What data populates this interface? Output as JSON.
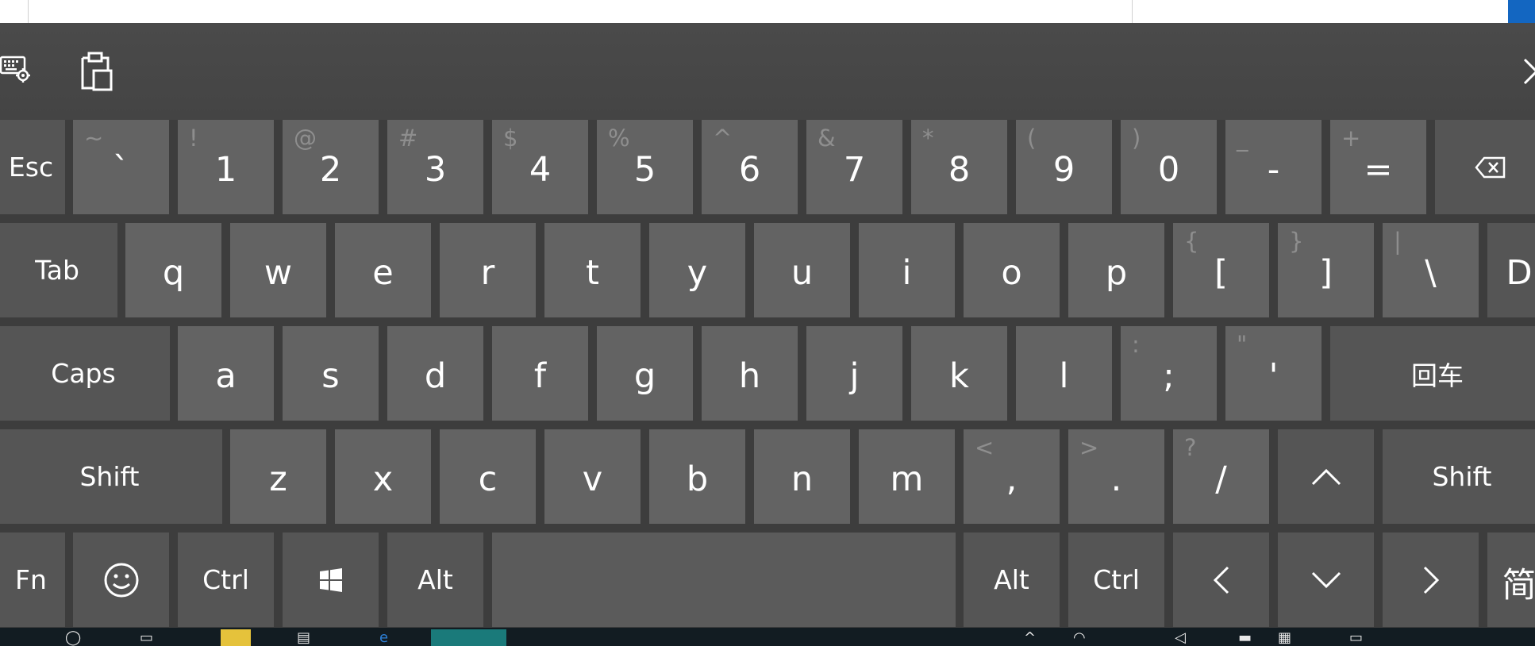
{
  "toolbar": {
    "settings_icon": "keyboard-settings-icon",
    "clipboard_icon": "clipboard-icon",
    "close_icon": "close-icon"
  },
  "rows": [
    [
      {
        "id": "esc",
        "main": "Esc"
      },
      {
        "id": "backtick",
        "main": "`",
        "sec": "~"
      },
      {
        "id": "1",
        "main": "1",
        "sec": "!"
      },
      {
        "id": "2",
        "main": "2",
        "sec": "@"
      },
      {
        "id": "3",
        "main": "3",
        "sec": "#"
      },
      {
        "id": "4",
        "main": "4",
        "sec": "$"
      },
      {
        "id": "5",
        "main": "5",
        "sec": "%"
      },
      {
        "id": "6",
        "main": "6",
        "sec": "^"
      },
      {
        "id": "7",
        "main": "7",
        "sec": "&"
      },
      {
        "id": "8",
        "main": "8",
        "sec": "*"
      },
      {
        "id": "9",
        "main": "9",
        "sec": "("
      },
      {
        "id": "0",
        "main": "0",
        "sec": ")"
      },
      {
        "id": "minus",
        "main": "-",
        "sec": "_"
      },
      {
        "id": "equals",
        "main": "=",
        "sec": "+"
      },
      {
        "id": "backspace",
        "main": "",
        "icon": "backspace-icon"
      }
    ],
    [
      {
        "id": "tab",
        "main": "Tab"
      },
      {
        "id": "q",
        "main": "q"
      },
      {
        "id": "w",
        "main": "w"
      },
      {
        "id": "e",
        "main": "e"
      },
      {
        "id": "r",
        "main": "r"
      },
      {
        "id": "t",
        "main": "t"
      },
      {
        "id": "y",
        "main": "y"
      },
      {
        "id": "u",
        "main": "u"
      },
      {
        "id": "i",
        "main": "i"
      },
      {
        "id": "o",
        "main": "o"
      },
      {
        "id": "p",
        "main": "p"
      },
      {
        "id": "lbracket",
        "main": "[",
        "sec": "{"
      },
      {
        "id": "rbracket",
        "main": "]",
        "sec": "}"
      },
      {
        "id": "backslash",
        "main": "\\",
        "sec": "|"
      },
      {
        "id": "del",
        "main": "D"
      }
    ],
    [
      {
        "id": "caps",
        "main": "Caps"
      },
      {
        "id": "a",
        "main": "a"
      },
      {
        "id": "s",
        "main": "s"
      },
      {
        "id": "d",
        "main": "d"
      },
      {
        "id": "f",
        "main": "f"
      },
      {
        "id": "g",
        "main": "g"
      },
      {
        "id": "h",
        "main": "h"
      },
      {
        "id": "j",
        "main": "j"
      },
      {
        "id": "k",
        "main": "k"
      },
      {
        "id": "l",
        "main": "l"
      },
      {
        "id": "semicolon",
        "main": ";",
        "sec": ":"
      },
      {
        "id": "quote",
        "main": "'",
        "sec": "\""
      },
      {
        "id": "enter",
        "main": "回车"
      }
    ],
    [
      {
        "id": "lshift",
        "main": "Shift"
      },
      {
        "id": "z",
        "main": "z"
      },
      {
        "id": "x",
        "main": "x"
      },
      {
        "id": "c",
        "main": "c"
      },
      {
        "id": "v",
        "main": "v"
      },
      {
        "id": "b",
        "main": "b"
      },
      {
        "id": "n",
        "main": "n"
      },
      {
        "id": "m",
        "main": "m"
      },
      {
        "id": "comma",
        "main": ",",
        "sec": "<"
      },
      {
        "id": "period",
        "main": ".",
        "sec": ">"
      },
      {
        "id": "slash",
        "main": "/",
        "sec": "?"
      },
      {
        "id": "up",
        "main": "",
        "icon": "arrow-up-icon"
      },
      {
        "id": "rshift",
        "main": "Shift"
      }
    ],
    [
      {
        "id": "fn",
        "main": "Fn"
      },
      {
        "id": "emoji",
        "main": "",
        "icon": "emoji-icon"
      },
      {
        "id": "lctrl",
        "main": "Ctrl"
      },
      {
        "id": "win",
        "main": "",
        "icon": "windows-icon"
      },
      {
        "id": "lalt",
        "main": "Alt"
      },
      {
        "id": "space",
        "main": ""
      },
      {
        "id": "ralt",
        "main": "Alt"
      },
      {
        "id": "rctrl",
        "main": "Ctrl"
      },
      {
        "id": "left",
        "main": "",
        "icon": "arrow-left-icon"
      },
      {
        "id": "down",
        "main": "",
        "icon": "arrow-down-icon"
      },
      {
        "id": "right",
        "main": "",
        "icon": "arrow-right-icon"
      },
      {
        "id": "lang",
        "main": "简"
      }
    ]
  ],
  "colors": {
    "key": "#636363",
    "function_key": "#555555",
    "board": "#3d3d3d",
    "toolbar": "#474747",
    "secondary_text": "#8e8e8e",
    "taskbar": "#121c22"
  }
}
